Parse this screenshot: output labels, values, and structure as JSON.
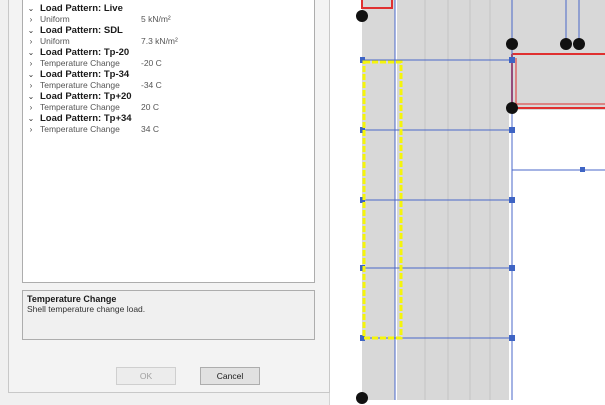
{
  "load_patterns": [
    {
      "label": "Load Pattern: Live",
      "items": [
        {
          "name": "Uniform",
          "value": "5 kN/m²"
        }
      ]
    },
    {
      "label": "Load Pattern: SDL",
      "items": [
        {
          "name": "Uniform",
          "value": "7.3 kN/m²"
        }
      ]
    },
    {
      "label": "Load Pattern: Tp-20",
      "items": [
        {
          "name": "Temperature Change",
          "value": "-20 C"
        }
      ]
    },
    {
      "label": "Load Pattern: Tp-34",
      "items": [
        {
          "name": "Temperature Change",
          "value": "-34 C"
        }
      ]
    },
    {
      "label": "Load Pattern: Tp+20",
      "items": [
        {
          "name": "Temperature Change",
          "value": "20 C"
        }
      ]
    },
    {
      "label": "Load Pattern: Tp+34",
      "items": [
        {
          "name": "Temperature Change",
          "value": "34 C"
        }
      ]
    }
  ],
  "description": {
    "title": "Temperature Change",
    "text": "Shell temperature change load."
  },
  "buttons": {
    "ok": "OK",
    "cancel": "Cancel"
  },
  "icons": {
    "expanded": "chevron-down-icon",
    "collapsed": "chevron-right-icon"
  },
  "colors": {
    "grid_line": "#4a67c8",
    "shell_fill": "#d8d8d8",
    "selection": "#f5f50a",
    "frame_red": "#e03030",
    "joint": "#111111",
    "node_blue": "#3e64c4"
  }
}
